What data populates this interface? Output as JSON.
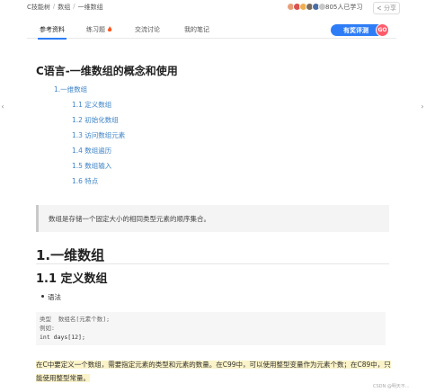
{
  "breadcrumb": {
    "items": [
      "C技能树",
      "数组",
      "一维数组"
    ],
    "sep": "/"
  },
  "header": {
    "learners": "805人已学习",
    "share": "分享"
  },
  "avatars": {
    "colors": [
      "#e8a07a",
      "#d9534f",
      "#f0ad4e",
      "#7a6b5d",
      "#4a6fa5",
      "#c8c8c8"
    ]
  },
  "tabs": [
    {
      "label": "参考资料"
    },
    {
      "label": "练习题"
    },
    {
      "label": "交流讨论"
    },
    {
      "label": "我的笔记"
    }
  ],
  "eval_button": {
    "label": "有奖评测",
    "go": "GO"
  },
  "article": {
    "title": "C语言-一维数组的概念和使用",
    "toc": [
      "1.一维数组",
      "1.1 定义数组",
      "1.2 初始化数组",
      "1.3 访问数组元素",
      "1.4 数组遍历",
      "1.5 数组输入",
      "1.6 特点"
    ],
    "quote": "数组是存储一个固定大小的相同类型元素的顺序集合。",
    "h1": "1.一维数组",
    "h2": "1.1 定义数组",
    "bullet": "语法",
    "code": [
      "类型  数组名[元素个数];",
      "例如:",
      "int days[12];"
    ],
    "para": "在C中要定义一个数组，需要指定元素的类型和元素的数量。在C99中，可以使用整型变量作为元素个数；在C89中，只能使用整型常量。"
  },
  "watermark": "CSDN @明天不..."
}
